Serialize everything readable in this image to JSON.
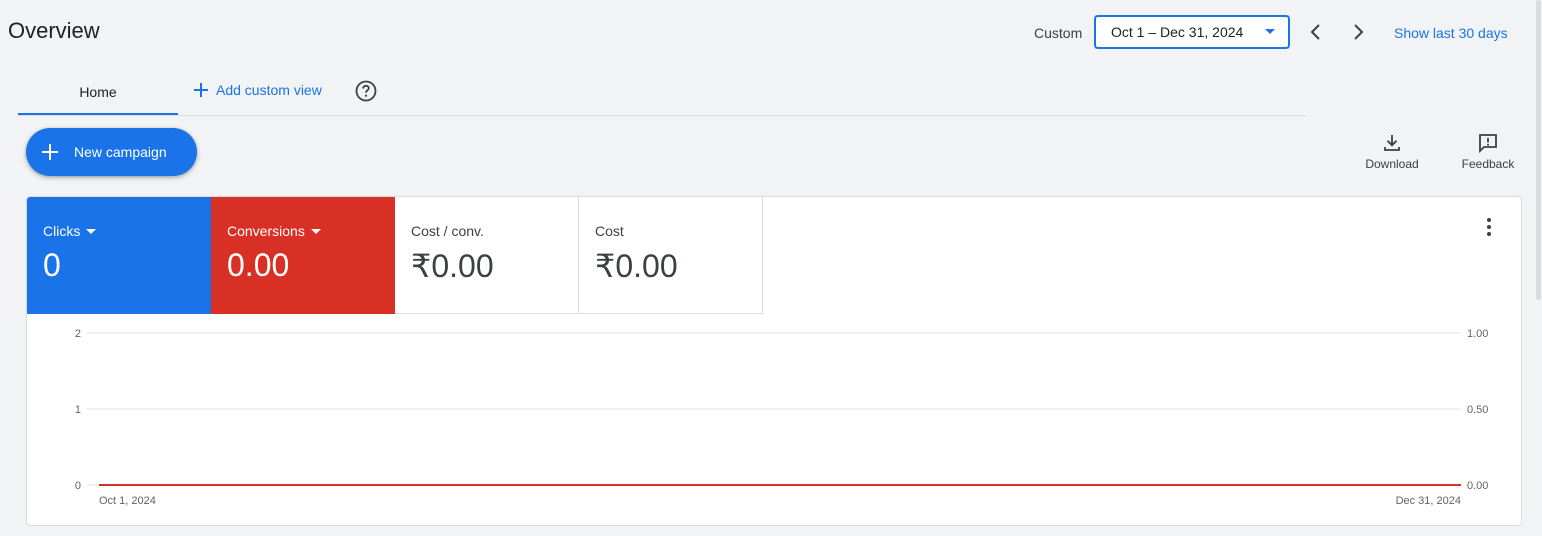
{
  "page": {
    "title": "Overview"
  },
  "date_range": {
    "label": "Custom",
    "value": "Oct 1 – Dec 31, 2024",
    "show_last_label": "Show last 30 days"
  },
  "tabs": {
    "home_label": "Home",
    "add_custom_view_label": "Add custom view"
  },
  "actions": {
    "new_campaign_label": "New campaign",
    "download_label": "Download",
    "feedback_label": "Feedback"
  },
  "metrics": [
    {
      "label": "Clicks",
      "value": "0",
      "color": "#1a73e8"
    },
    {
      "label": "Conversions",
      "value": "0.00",
      "color": "#d93025"
    },
    {
      "label": "Cost / conv.",
      "value": "₹0.00"
    },
    {
      "label": "Cost",
      "value": "₹0.00"
    }
  ],
  "chart_data": {
    "type": "line",
    "x": [
      "Oct 1, 2024",
      "Dec 31, 2024"
    ],
    "x_tick_labels": [
      "Oct 1, 2024",
      "Dec 31, 2024"
    ],
    "y_left_ticks": [
      "2",
      "1",
      "0"
    ],
    "y_right_ticks": [
      "1.00",
      "0.50",
      "0.00"
    ],
    "ylim_left": [
      0,
      2
    ],
    "ylim_right": [
      0,
      1
    ],
    "grid": true,
    "series": [
      {
        "name": "Clicks",
        "axis": "left",
        "values": [
          0,
          0
        ],
        "color": "#1a73e8"
      },
      {
        "name": "Conversions",
        "axis": "right",
        "values": [
          0,
          0
        ],
        "color": "#d93025"
      }
    ]
  }
}
